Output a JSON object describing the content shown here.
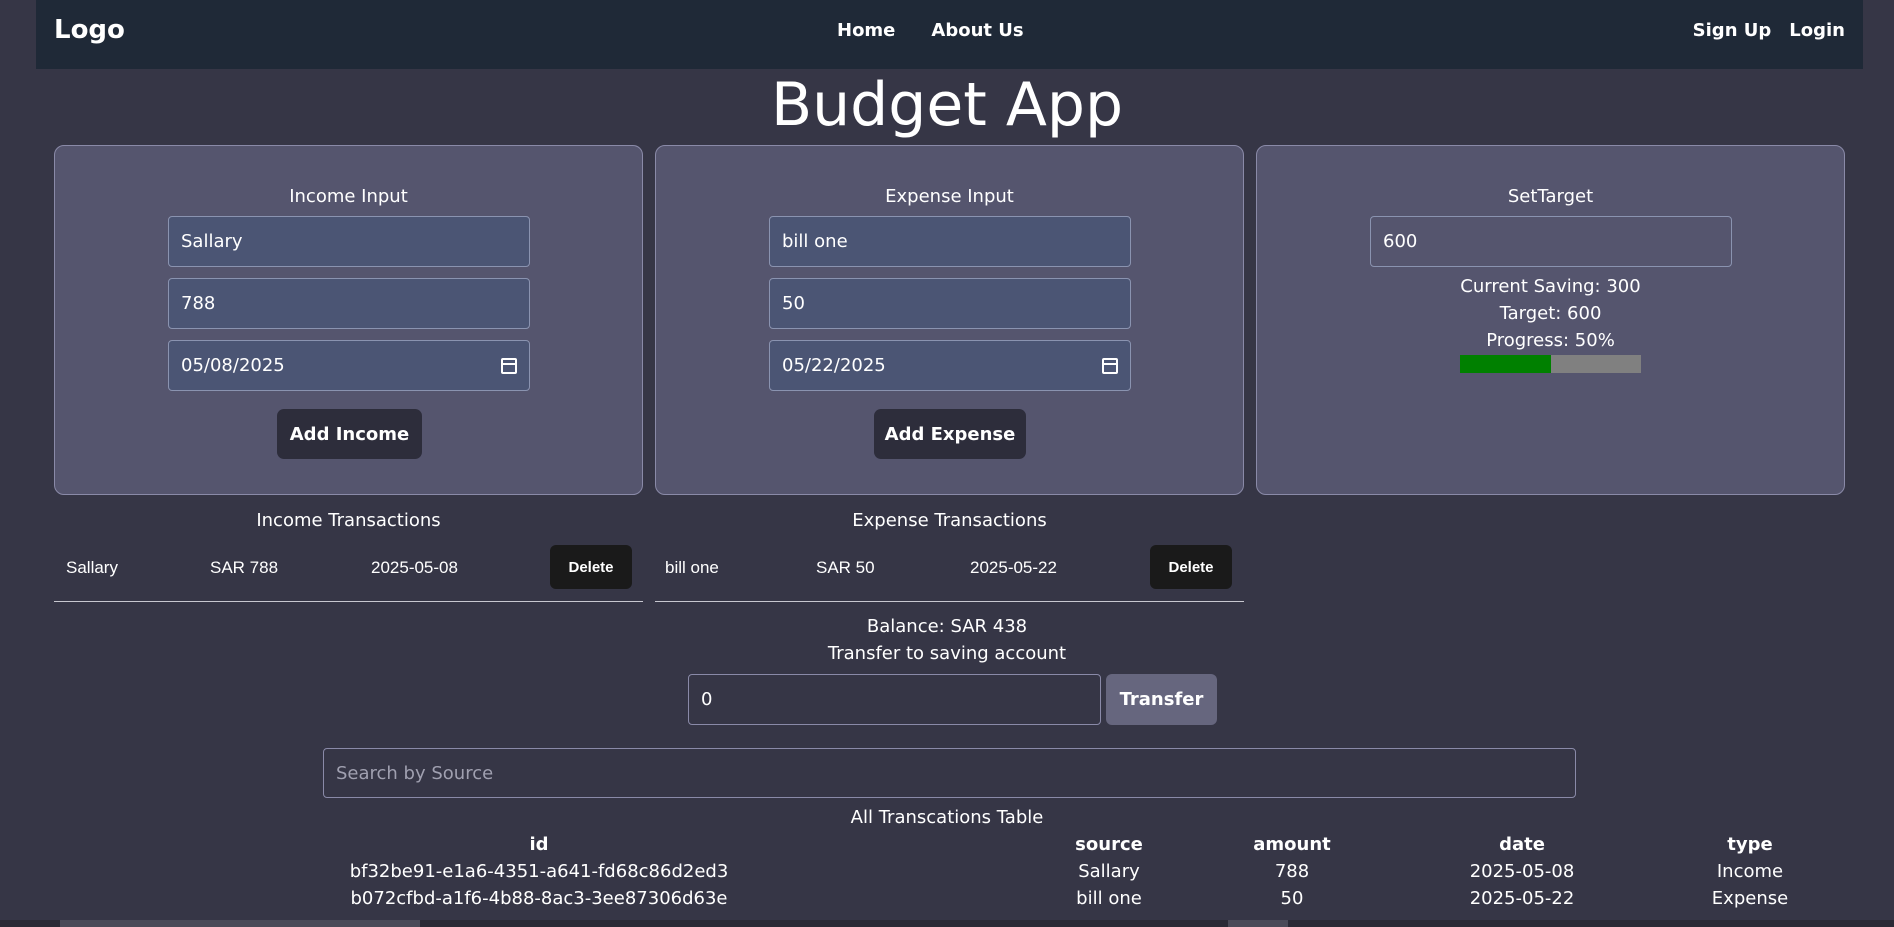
{
  "nav": {
    "logo": "Logo",
    "home": "Home",
    "about": "About Us",
    "signup": "Sign Up",
    "login": "Login"
  },
  "title": "Budget App",
  "income": {
    "title": "Income Input",
    "source": "Sallary",
    "amount": "788",
    "date": "05/08/2025",
    "button": "Add Income"
  },
  "expense": {
    "title": "Expense Input",
    "source": "bill one",
    "amount": "50",
    "date": "05/22/2025",
    "button": "Add Expense"
  },
  "target": {
    "title": "SetTarget",
    "value": "600",
    "current_saving": "Current Saving: 300",
    "target_text": "Target: 600",
    "progress_text": "Progress: 50%",
    "progress": 0.5,
    "progress_color": "#008000",
    "track_color": "#808080"
  },
  "income_transactions": {
    "title": "Income Transactions",
    "rows": [
      {
        "source": "Sallary",
        "amount": "SAR 788",
        "date": "2025-05-08",
        "delete": "Delete"
      }
    ]
  },
  "expense_transactions": {
    "title": "Expense Transactions",
    "rows": [
      {
        "source": "bill one",
        "amount": "SAR 50",
        "date": "2025-05-22",
        "delete": "Delete"
      }
    ]
  },
  "balance": {
    "text": "Balance: SAR 438",
    "transfer_label": "Transfer to saving account",
    "transfer_value": "0",
    "transfer_button": "Transfer"
  },
  "search": {
    "placeholder": "Search by Source"
  },
  "table": {
    "title": "All Transcations Table",
    "headers": [
      "id",
      "source",
      "amount",
      "date",
      "type"
    ],
    "rows": [
      [
        "bf32be91-e1a6-4351-a641-fd68c86d2ed3",
        "Sallary",
        "788",
        "2025-05-08",
        "Income"
      ],
      [
        "b072cfbd-a1f6-4b88-8ac3-3ee87306d63e",
        "bill one",
        "50",
        "2025-05-22",
        "Expense"
      ]
    ]
  }
}
